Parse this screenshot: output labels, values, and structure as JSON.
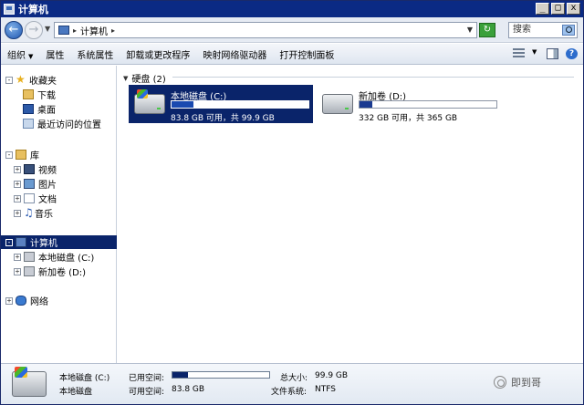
{
  "window": {
    "title": "计算机"
  },
  "titlebar_buttons": {
    "minimize": "_",
    "maximize": "□",
    "close": "x"
  },
  "address": {
    "path": "计算机",
    "search_placeholder": "搜索"
  },
  "toolbar": {
    "organize": "组织",
    "properties": "属性",
    "system_properties": "系统属性",
    "uninstall": "卸载或更改程序",
    "map_drive": "映射网络驱动器",
    "control_panel": "打开控制面板"
  },
  "nav": {
    "favorites": "收藏夹",
    "downloads": "下载",
    "desktop": "桌面",
    "recent": "最近访问的位置",
    "libraries": "库",
    "videos": "视频",
    "pictures": "图片",
    "documents": "文档",
    "music": "音乐",
    "computer": "计算机",
    "local_disk_c": "本地磁盘 (C:)",
    "new_volume_d": "新加卷 (D:)",
    "network": "网络"
  },
  "content": {
    "group_title": "硬盘 (2)",
    "drives": [
      {
        "name": "本地磁盘 (C:)",
        "sub": "83.8 GB 可用，共 99.9 GB",
        "used_fraction": 0.16,
        "selected": true
      },
      {
        "name": "新加卷 (D:)",
        "sub": "332 GB 可用，共 365 GB",
        "used_fraction": 0.09,
        "selected": false
      }
    ]
  },
  "details": {
    "name": "本地磁盘 (C:)",
    "type": "本地磁盘",
    "used_label": "已用空间:",
    "free_label": "可用空间:",
    "free_value": "83.8 GB",
    "total_label": "总大小:",
    "total_value": "99.9 GB",
    "fs_label": "文件系统:",
    "fs_value": "NTFS",
    "used_fraction": 0.16
  },
  "watermark": {
    "text": "即到哥"
  }
}
